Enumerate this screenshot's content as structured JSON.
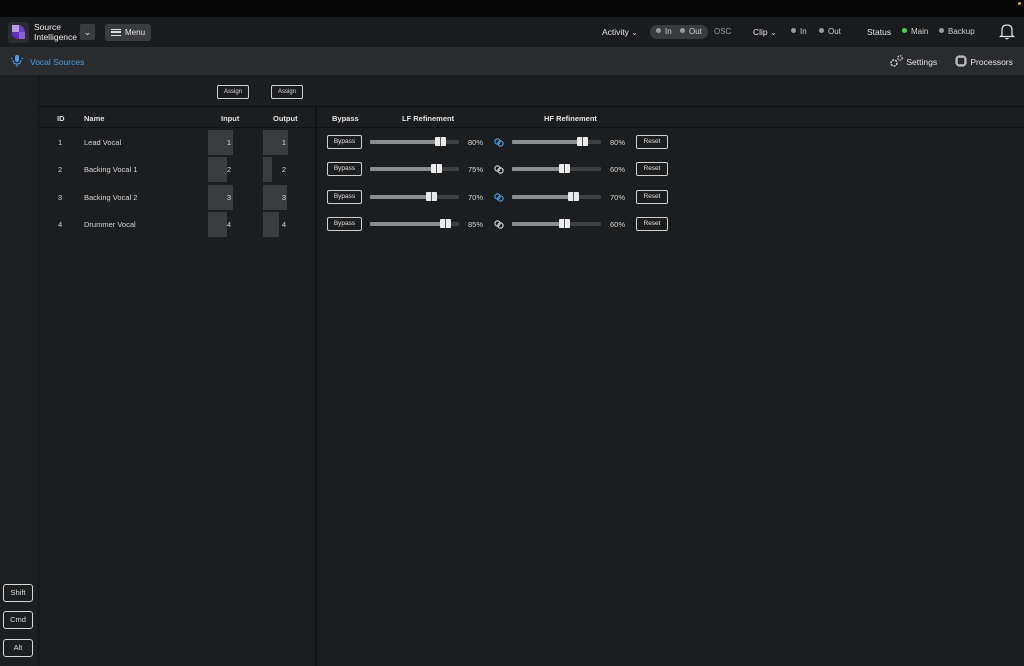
{
  "app": {
    "name_line1": "Source",
    "name_line2": "Intelligence",
    "menu_label": "Menu"
  },
  "header": {
    "activity_label": "Activity",
    "in_label": "In",
    "out_label": "Out",
    "osc_label": "OSC",
    "clip_label": "Clip",
    "clip_in_label": "In",
    "clip_out_label": "Out",
    "status_label": "Status",
    "main_label": "Main",
    "backup_label": "Backup",
    "colors": {
      "status_main": "#4cd24c",
      "accent": "#4c9de6"
    }
  },
  "subbar": {
    "tab_label": "Vocal Sources",
    "settings_label": "Settings",
    "processors_label": "Processors"
  },
  "assign_input_label": "Assign",
  "assign_output_label": "Assign",
  "columns": {
    "id": "ID",
    "name": "Name",
    "input": "Input",
    "output": "Output",
    "bypass": "Bypass",
    "lf": "LF Refinement",
    "hf": "HF Refinement"
  },
  "rows": [
    {
      "id": "1",
      "name": "Lead Vocal",
      "input": "1",
      "output": "1",
      "input_level": 1.0,
      "output_level": 1.0,
      "bypass_label": "Bypass",
      "lf_value": 80,
      "lf_label": "80%",
      "linked": true,
      "hf_value": 80,
      "hf_label": "80%",
      "reset_label": "Reset"
    },
    {
      "id": "2",
      "name": "Backing Vocal 1",
      "input": "2",
      "output": "2",
      "input_level": 0.75,
      "output_level": 0.35,
      "bypass_label": "Bypass",
      "lf_value": 75,
      "lf_label": "75%",
      "linked": false,
      "hf_value": 60,
      "hf_label": "60%",
      "reset_label": "Reset"
    },
    {
      "id": "3",
      "name": "Backing Vocal 2",
      "input": "3",
      "output": "3",
      "input_level": 1.0,
      "output_level": 0.95,
      "bypass_label": "Bypass",
      "lf_value": 70,
      "lf_label": "70%",
      "linked": true,
      "hf_value": 70,
      "hf_label": "70%",
      "reset_label": "Reset"
    },
    {
      "id": "4",
      "name": "Drummer Vocal",
      "input": "4",
      "output": "4",
      "input_level": 0.75,
      "output_level": 0.65,
      "bypass_label": "Bypass",
      "lf_value": 85,
      "lf_label": "85%",
      "linked": false,
      "hf_value": 60,
      "hf_label": "60%",
      "reset_label": "Reset"
    }
  ],
  "modifiers": {
    "shift": "Shift",
    "cmd": "Cmd",
    "alt": "Alt"
  }
}
